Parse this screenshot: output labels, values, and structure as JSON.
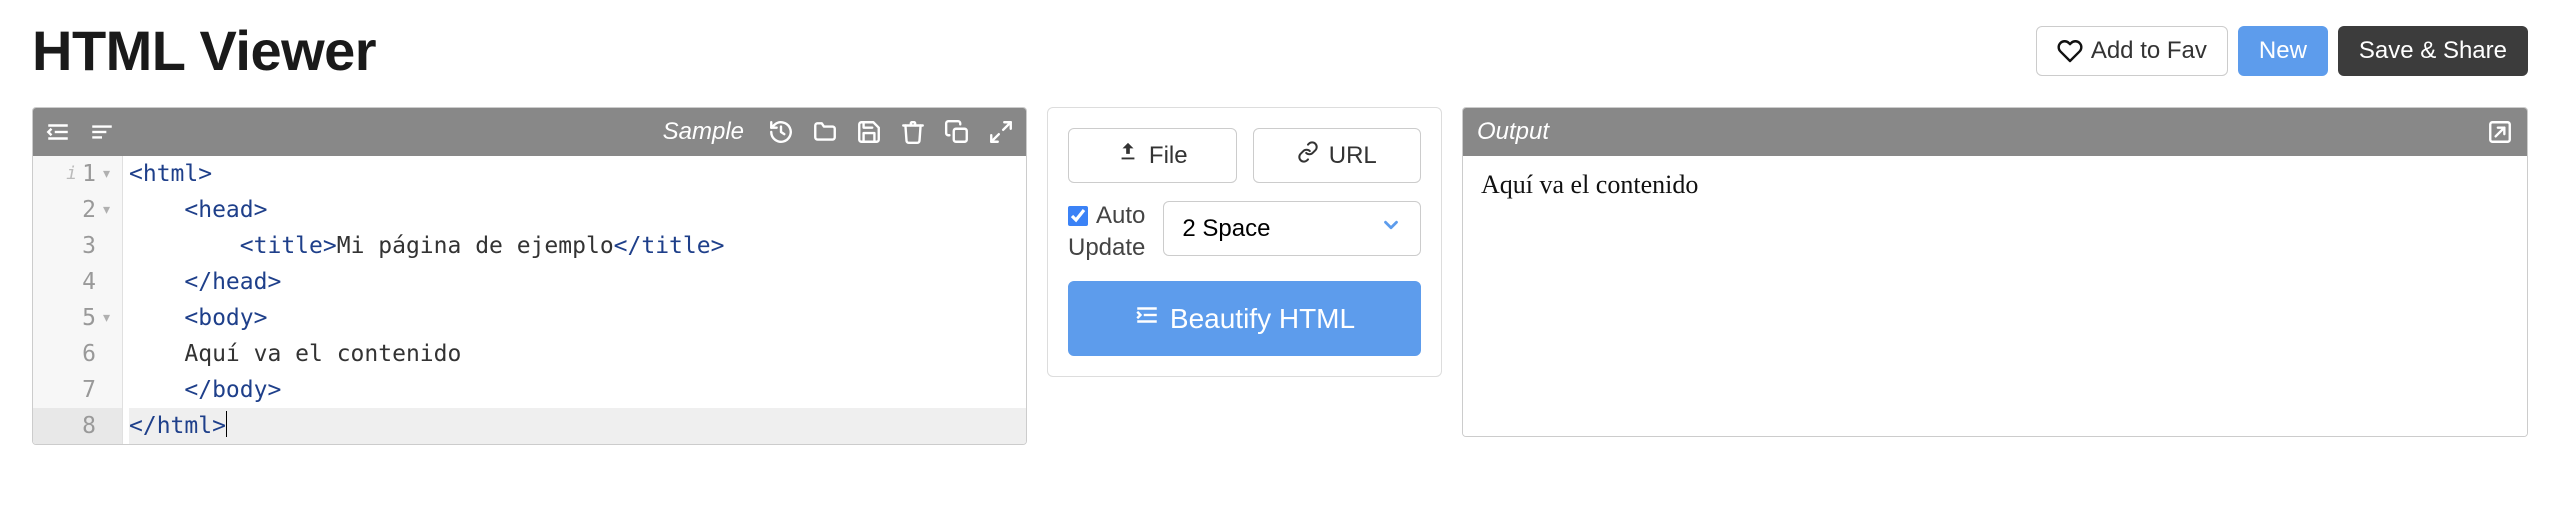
{
  "page": {
    "title": "HTML Viewer"
  },
  "header_buttons": {
    "fav": "Add to Fav",
    "new": "New",
    "save": "Save & Share"
  },
  "editor": {
    "sample_label": "Sample",
    "lines": [
      {
        "num": "1",
        "fold": true,
        "info": true,
        "indent": "",
        "open_tag": "<html>",
        "text": "",
        "close_tag": ""
      },
      {
        "num": "2",
        "fold": true,
        "info": false,
        "indent": "    ",
        "open_tag": "<head>",
        "text": "",
        "close_tag": ""
      },
      {
        "num": "3",
        "fold": false,
        "info": false,
        "indent": "        ",
        "open_tag": "<title>",
        "text": "Mi página de ejemplo",
        "close_tag": "</title>"
      },
      {
        "num": "4",
        "fold": false,
        "info": false,
        "indent": "    ",
        "open_tag": "</head>",
        "text": "",
        "close_tag": ""
      },
      {
        "num": "5",
        "fold": true,
        "info": false,
        "indent": "    ",
        "open_tag": "<body>",
        "text": "",
        "close_tag": ""
      },
      {
        "num": "6",
        "fold": false,
        "info": false,
        "indent": "    ",
        "open_tag": "",
        "text": "Aquí va el contenido",
        "close_tag": ""
      },
      {
        "num": "7",
        "fold": false,
        "info": false,
        "indent": "    ",
        "open_tag": "</body>",
        "text": "",
        "close_tag": ""
      },
      {
        "num": "8",
        "fold": false,
        "info": false,
        "indent": "",
        "open_tag": "</html>",
        "text": "",
        "close_tag": ""
      }
    ],
    "active_line_index": 7
  },
  "middle": {
    "file": "File",
    "url": "URL",
    "auto_update": "Auto Update",
    "auto_update_word1": "Auto",
    "auto_update_word2": "Update",
    "auto_update_checked": true,
    "indent_option": "2 Space",
    "beautify": "Beautify HTML"
  },
  "output": {
    "label": "Output",
    "content": "Aquí va el contenido"
  }
}
